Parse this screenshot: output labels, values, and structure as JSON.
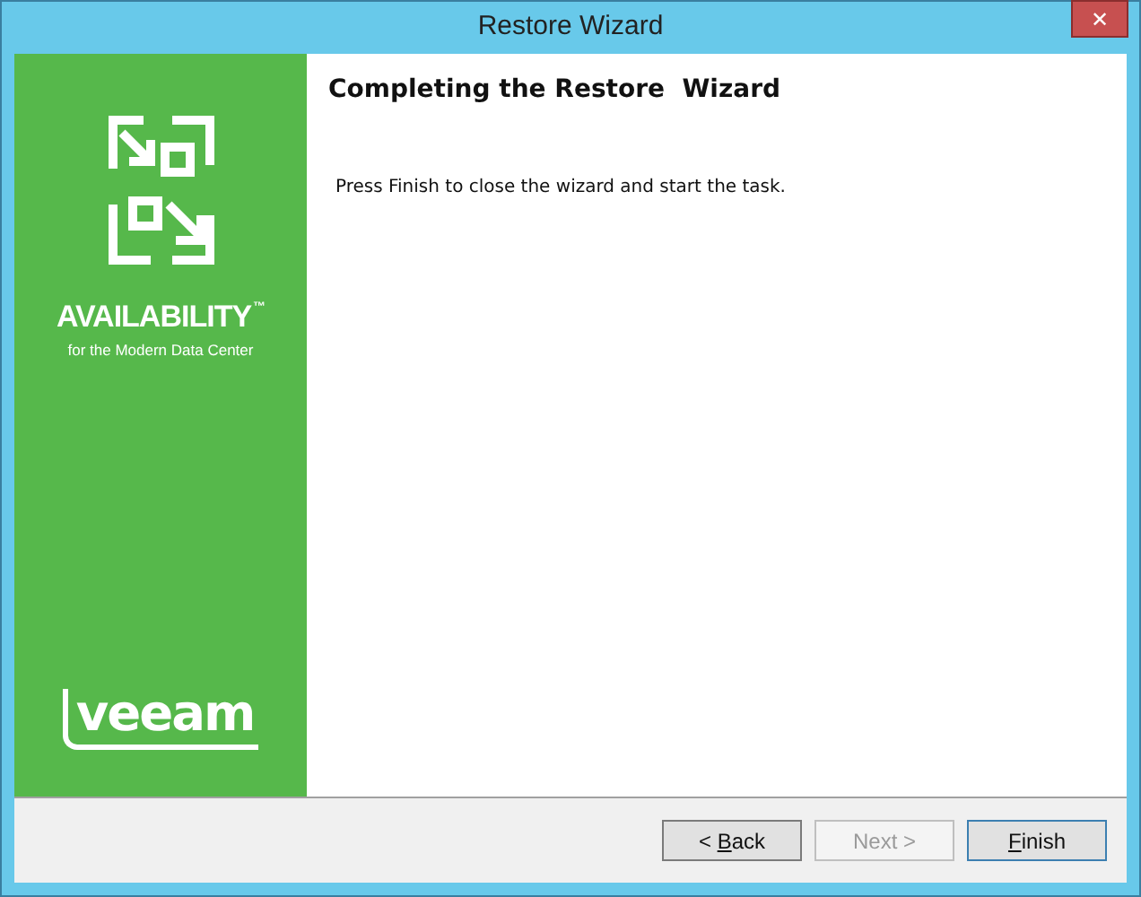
{
  "window": {
    "title": "Restore Wizard",
    "close_label": "✕"
  },
  "banner": {
    "tagline": "AVAILABILITY",
    "trademark": "™",
    "subtitle": "for the Modern Data Center",
    "logo_text": "veeam"
  },
  "page": {
    "heading": "Completing the Restore  Wizard",
    "message": "Press Finish to close the wizard and start the task."
  },
  "buttons": [
    {
      "before": "< ",
      "mnemonic": "B",
      "after": "ack",
      "disabled": false,
      "default": false
    },
    {
      "before": "Next >",
      "disabled": true,
      "default": false
    },
    {
      "mnemonic": "F",
      "after": "inish",
      "disabled": false,
      "default": true
    }
  ]
}
